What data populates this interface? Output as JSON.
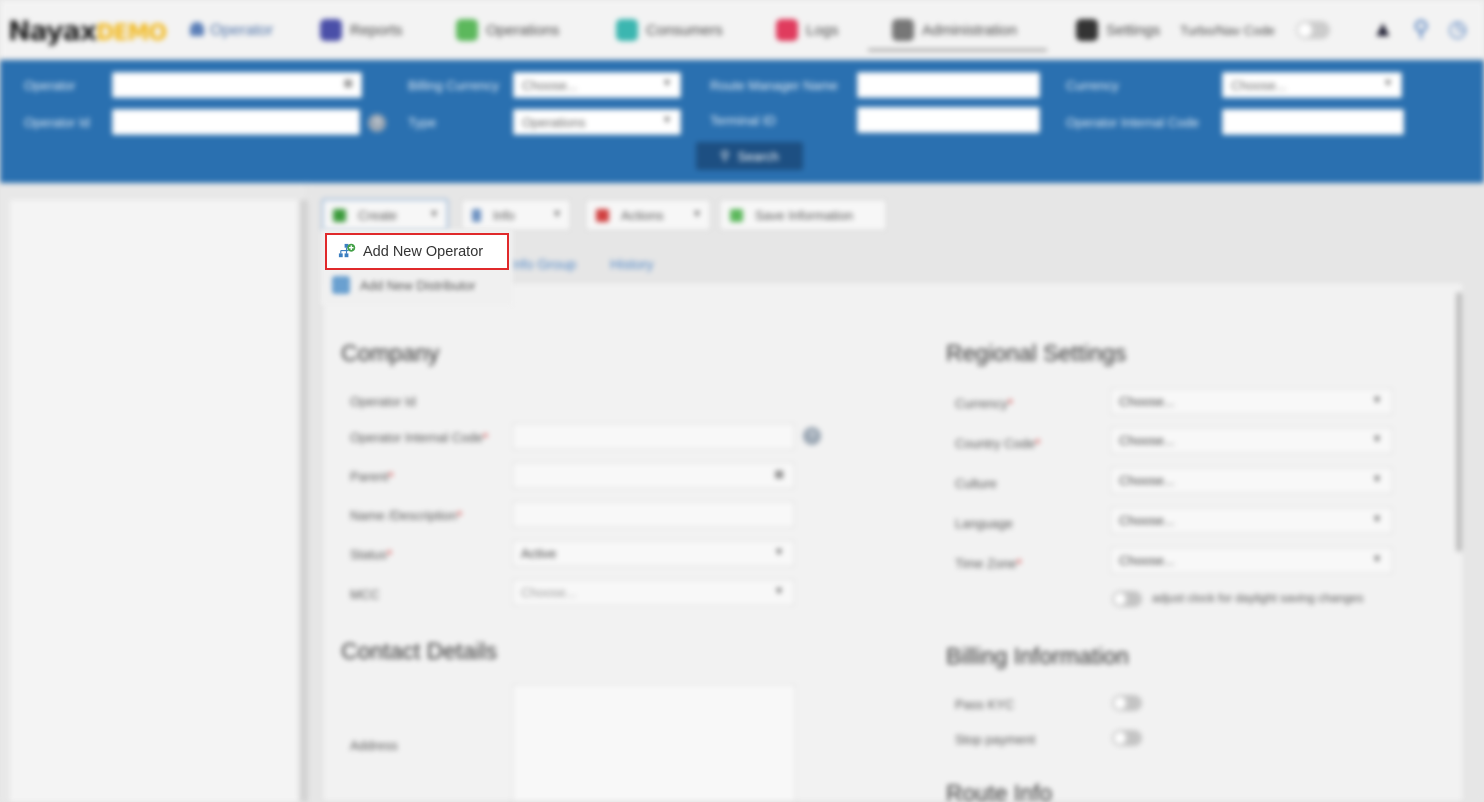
{
  "brand": {
    "name": "Nayax",
    "suffix": "DEMO"
  },
  "nav": {
    "role": "Operator",
    "items": [
      {
        "label": "Reports",
        "icon": "reports-icon",
        "color": "#4a4fa8"
      },
      {
        "label": "Operations",
        "icon": "operations-icon",
        "color": "#5cb85c"
      },
      {
        "label": "Consumers",
        "icon": "consumers-icon",
        "color": "#3bb6b0"
      },
      {
        "label": "Logs",
        "icon": "logs-icon",
        "color": "#e03b5d"
      },
      {
        "label": "Administration",
        "icon": "administration-icon",
        "color": "#777777"
      },
      {
        "label": "Settings",
        "icon": "settings-icon",
        "color": "#333333"
      }
    ],
    "user_label": "Turbo/Nav Code"
  },
  "search": {
    "operator_label": "Operator",
    "operator_id_label": "Operator Id",
    "billing_currency_label": "Billing Currency",
    "billing_currency_value": "Choose...",
    "type_label": "Type",
    "type_value": "Operations",
    "route_manager_label": "Route Manager Name",
    "terminal_id_label": "Terminal ID",
    "currency_label": "Currency",
    "currency_value": "Choose...",
    "internal_code_label": "Operator Internal Code",
    "search_button": "Search"
  },
  "toolbar": {
    "create_label": "Create",
    "info_label": "Info",
    "actions_label": "Actions",
    "save_label": "Save Information"
  },
  "tabs": {
    "group_label": "Info Group",
    "history_label": "History"
  },
  "dropdown": {
    "add_operator": "Add New Operator",
    "add_distributor": "Add New Distributor"
  },
  "company": {
    "title": "Company",
    "operator_id_label": "Operator Id",
    "internal_code_label": "Operator Internal Code",
    "parent_label": "Parent",
    "name_label": "Name /Description",
    "status_label": "Status",
    "status_value": "Active",
    "mcc_label": "MCC",
    "mcc_value": "Choose..."
  },
  "contact": {
    "title": "Contact Details",
    "address_label": "Address"
  },
  "regional": {
    "title": "Regional Settings",
    "currency_label": "Currency",
    "country_label": "Country Code",
    "culture_label": "Culture",
    "language_label": "Language",
    "timezone_label": "Time Zone",
    "choose": "Choose...",
    "dst_label": "adjust clock for daylight saving changes"
  },
  "billing": {
    "title": "Billing Information",
    "kyc_label": "Pass KYC",
    "stop_label": "Stop payment"
  },
  "route": {
    "title": "Route Info"
  }
}
